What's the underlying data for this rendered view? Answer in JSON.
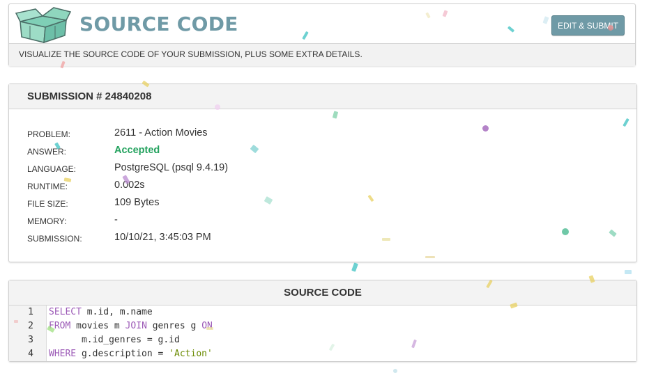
{
  "header": {
    "title": "SOURCE CODE",
    "edit_button_label": "EDIT & SUBMIT",
    "subtitle": "VISUALIZE THE SOURCE CODE OF YOUR SUBMISSION, PLUS SOME EXTRA DETAILS.",
    "logo_icon": "open-box-logo-icon"
  },
  "submission": {
    "heading": "SUBMISSION # 24840208",
    "details": [
      {
        "label": "PROBLEM:",
        "value": "2611 - Action Movies"
      },
      {
        "label": "ANSWER:",
        "value": "Accepted"
      },
      {
        "label": "LANGUAGE:",
        "value": "PostgreSQL (psql 9.4.19)"
      },
      {
        "label": "RUNTIME:",
        "value": "0.002s"
      },
      {
        "label": "FILE SIZE:",
        "value": "109 Bytes"
      },
      {
        "label": "MEMORY:",
        "value": "-"
      },
      {
        "label": "SUBMISSION:",
        "value": "10/10/21, 3:45:03 PM"
      }
    ]
  },
  "source": {
    "heading": "SOURCE CODE",
    "lines": [
      {
        "num": "1",
        "tokens": [
          {
            "t": "SELECT",
            "k": "kw"
          },
          {
            "t": " m.id, m.name",
            "k": ""
          }
        ]
      },
      {
        "num": "2",
        "tokens": [
          {
            "t": "FROM",
            "k": "kw"
          },
          {
            "t": " movies m ",
            "k": ""
          },
          {
            "t": "JOIN",
            "k": "kw"
          },
          {
            "t": " genres g ",
            "k": ""
          },
          {
            "t": "ON",
            "k": "kw"
          }
        ]
      },
      {
        "num": "3",
        "tokens": [
          {
            "t": "      m.id_genres = g.id",
            "k": ""
          }
        ]
      },
      {
        "num": "4",
        "tokens": [
          {
            "t": "WHERE",
            "k": "kw"
          },
          {
            "t": " g.description = ",
            "k": ""
          },
          {
            "t": "'Action'",
            "k": "str"
          }
        ]
      }
    ]
  },
  "colors": {
    "accent": "#6f9aa6",
    "accepted": "#23a25e",
    "keyword": "#9b59b6",
    "string": "#6a8a00"
  }
}
